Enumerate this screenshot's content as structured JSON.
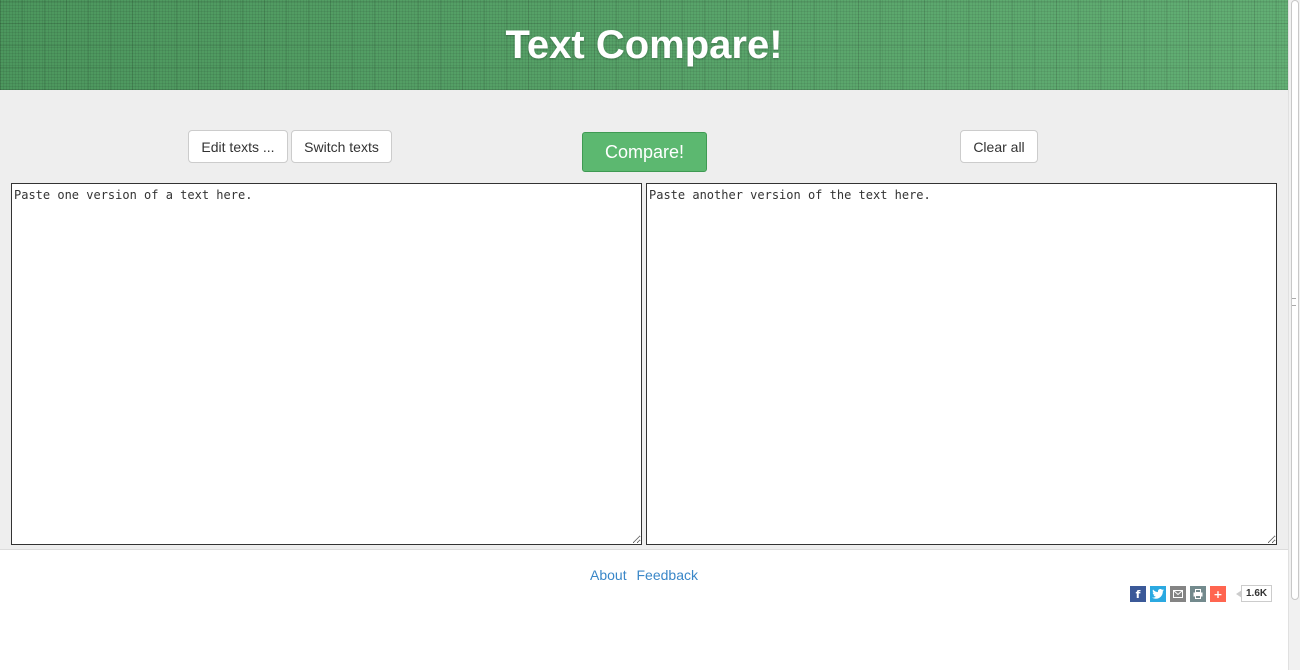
{
  "header": {
    "title": "Text Compare!"
  },
  "toolbar": {
    "edit_label": "Edit texts ...",
    "switch_label": "Switch texts",
    "compare_label": "Compare!",
    "clear_label": "Clear all"
  },
  "editors": {
    "left_placeholder": "Paste one version of a text here.",
    "right_placeholder": "Paste another version of the text here."
  },
  "footer": {
    "links": [
      {
        "label": "About"
      },
      {
        "label": "Feedback"
      }
    ],
    "share_icons": [
      "facebook-icon",
      "twitter-icon",
      "email-icon",
      "print-icon",
      "more-share-icon"
    ],
    "share_count": "1.6K"
  },
  "colors": {
    "header_green": "#55a868",
    "compare_button": "#5cb870",
    "link": "#3a87c8",
    "workarea_bg": "#eeeeee"
  }
}
